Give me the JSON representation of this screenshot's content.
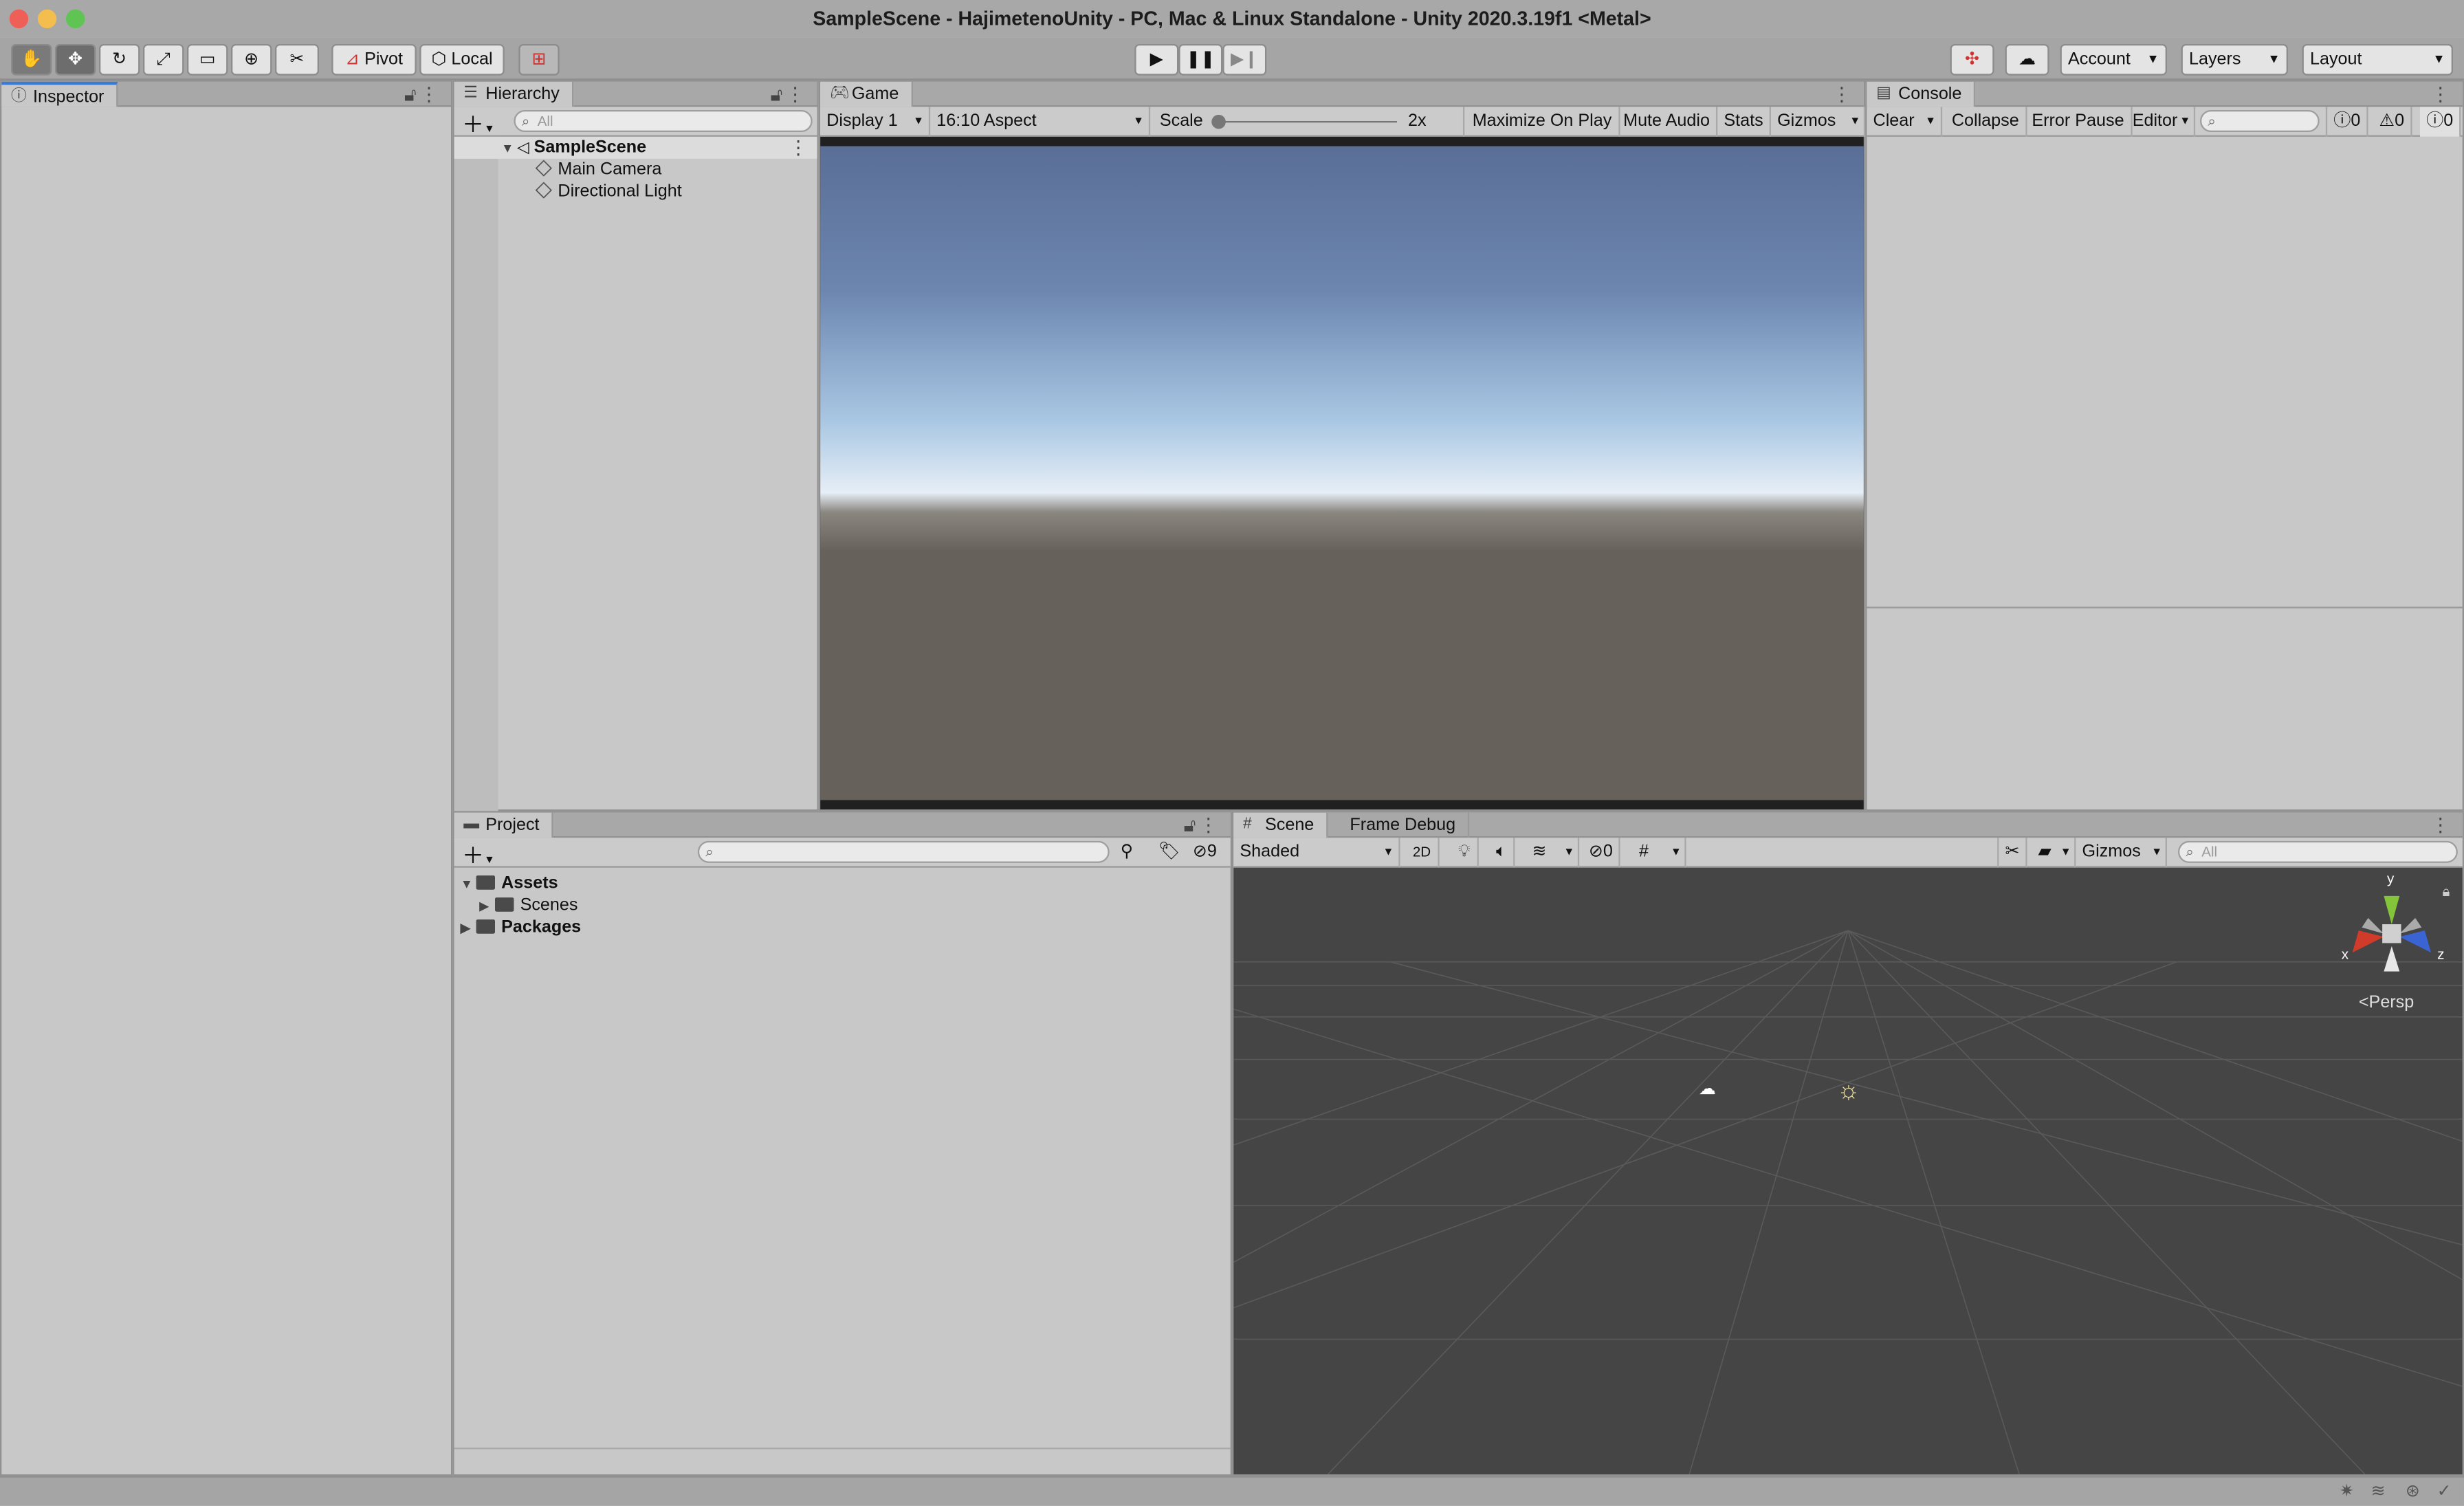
{
  "window": {
    "title": "SampleScene - HajimetenoUnity - PC, Mac & Linux Standalone - Unity 2020.3.19f1 <Metal>"
  },
  "toolbar": {
    "pivot_label": "Pivot",
    "local_label": "Local",
    "account_label": "Account",
    "layers_label": "Layers",
    "layout_label": "Layout"
  },
  "inspector": {
    "tab_label": "Inspector"
  },
  "hierarchy": {
    "tab_label": "Hierarchy",
    "search_placeholder": "All",
    "scene_name": "SampleScene",
    "items": [
      {
        "label": "Main Camera"
      },
      {
        "label": "Directional Light"
      }
    ]
  },
  "game": {
    "tab_label": "Game",
    "display": "Display 1",
    "aspect": "16:10 Aspect",
    "scale_label": "Scale",
    "scale_value": "2x",
    "maximize_label": "Maximize On Play",
    "mute_label": "Mute Audio",
    "stats_label": "Stats",
    "gizmos_label": "Gizmos"
  },
  "console": {
    "tab_label": "Console",
    "clear_label": "Clear",
    "collapse_label": "Collapse",
    "error_pause_label": "Error Pause",
    "editor_label": "Editor",
    "log_count": "0",
    "warning_count": "0",
    "error_count": "0"
  },
  "project": {
    "tab_label": "Project",
    "hidden_count": "9",
    "tree": [
      {
        "label": "Assets"
      },
      {
        "label": "Scenes"
      },
      {
        "label": "Packages"
      }
    ]
  },
  "scene": {
    "tab_label": "Scene",
    "frame_debug_label": "Frame Debug",
    "shading_mode": "Shaded",
    "toggle_2d": "2D",
    "hidden_count": "0",
    "gizmos_label": "Gizmos",
    "search_placeholder": "All",
    "axis_y": "y",
    "axis_x": "x",
    "axis_z": "z",
    "projection_label": "Persp"
  },
  "colors": {
    "editor_bg": "#c8c8c8",
    "scene_bg": "#454545",
    "sky_top": "#5a6e96",
    "horizon": "#e6eef6",
    "ground": "#67615b",
    "close": "#ee5f57",
    "minimize": "#f4be4f",
    "maximize": "#5fc454"
  }
}
